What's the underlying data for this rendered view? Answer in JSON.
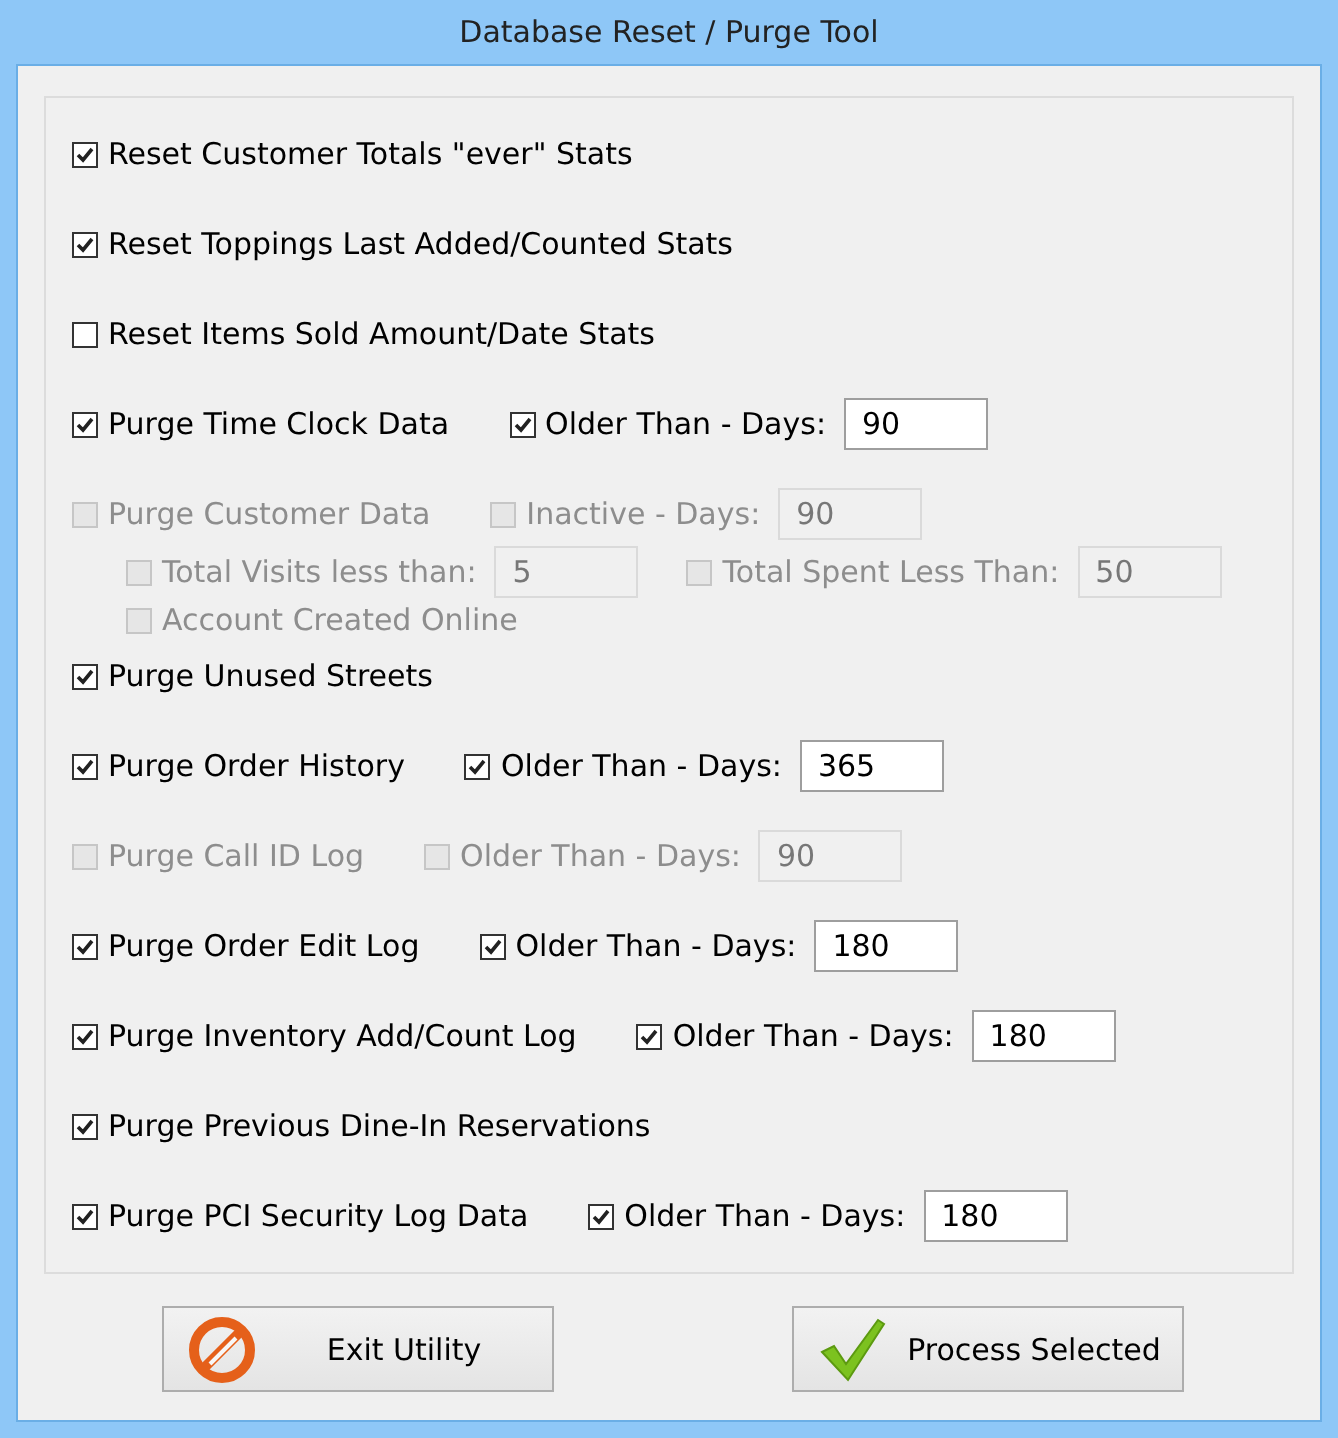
{
  "window": {
    "title": "Database Reset / Purge Tool"
  },
  "options": [
    {
      "label": "Reset Customer Totals \"ever\" Stats",
      "checked": true,
      "disabled": false
    },
    {
      "label": "Reset Toppings Last Added/Counted Stats",
      "checked": true,
      "disabled": false
    },
    {
      "label": "Reset Items Sold Amount/Date Stats",
      "checked": false,
      "disabled": false
    },
    {
      "label": "Purge Time Clock Data",
      "checked": true,
      "disabled": false,
      "filter": {
        "label": "Older Than - Days:",
        "checked": true,
        "value": "90"
      }
    },
    {
      "label": "Purge Customer Data",
      "checked": false,
      "disabled": true,
      "filter": {
        "label": "Inactive - Days:",
        "checked": false,
        "value": "90"
      },
      "sub_rows": [
        {
          "items": [
            {
              "label": "Total Visits less than:",
              "checked": false,
              "value": "5"
            },
            {
              "label": "Total Spent Less Than:",
              "checked": false,
              "value": "50"
            }
          ]
        },
        {
          "items": [
            {
              "label": "Account Created Online",
              "checked": false
            }
          ]
        }
      ]
    },
    {
      "label": "Purge Unused Streets",
      "checked": true,
      "disabled": false
    },
    {
      "label": "Purge Order History",
      "checked": true,
      "disabled": false,
      "filter": {
        "label": "Older Than - Days:",
        "checked": true,
        "value": "365"
      }
    },
    {
      "label": "Purge Call ID Log",
      "checked": false,
      "disabled": true,
      "filter": {
        "label": "Older Than - Days:",
        "checked": false,
        "value": "90"
      }
    },
    {
      "label": "Purge Order Edit Log",
      "checked": true,
      "disabled": false,
      "filter": {
        "label": "Older Than - Days:",
        "checked": true,
        "value": "180"
      }
    },
    {
      "label": "Purge Inventory Add/Count Log",
      "checked": true,
      "disabled": false,
      "filter": {
        "label": "Older Than - Days:",
        "checked": true,
        "value": "180"
      }
    },
    {
      "label": "Purge Previous Dine-In Reservations",
      "checked": true,
      "disabled": false
    },
    {
      "label": "Purge PCI Security Log Data",
      "checked": true,
      "disabled": false,
      "filter": {
        "label": "Older Than - Days:",
        "checked": true,
        "value": "180"
      }
    }
  ],
  "buttons": [
    {
      "kind": "exit",
      "label": "Exit Utility"
    },
    {
      "kind": "process",
      "label": "Process Selected"
    }
  ]
}
